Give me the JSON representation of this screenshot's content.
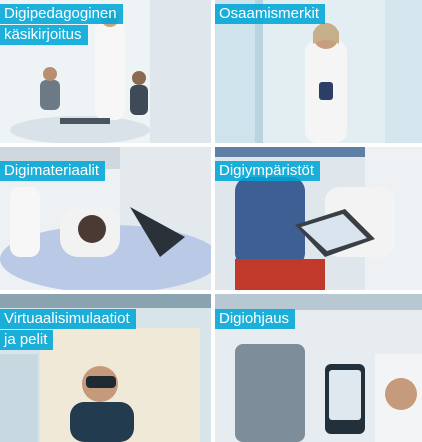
{
  "tiles": [
    {
      "id": "digipedagoginen",
      "lines": [
        "Digipedagoginen",
        "käsikirjoitus"
      ]
    },
    {
      "id": "osaamismerkit",
      "lines": [
        "Osaamismerkit"
      ]
    },
    {
      "id": "digimateriaalit",
      "lines": [
        "Digimateriaalit"
      ]
    },
    {
      "id": "digiymparistot",
      "lines": [
        "Digiympäristöt"
      ]
    },
    {
      "id": "virtuaalisimulaatiot",
      "lines": [
        "Virtuaalisimulaatiot",
        "ja pelit"
      ]
    },
    {
      "id": "digiohjaus",
      "lines": [
        "Digiohjaus"
      ]
    }
  ],
  "colors": {
    "label_bg": "#00a6d6",
    "label_text": "#ffffff"
  }
}
